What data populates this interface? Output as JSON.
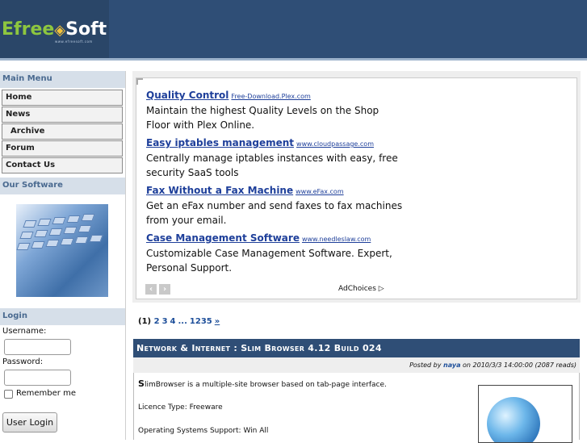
{
  "header": {
    "logo_left": "Efree",
    "logo_right": "Soft",
    "logo_sub": "www.efreesoft.com"
  },
  "sidebar": {
    "main_menu_title": "Main Menu",
    "menu": [
      {
        "label": "Home"
      },
      {
        "label": "News"
      },
      {
        "label": "Archive"
      },
      {
        "label": "Forum"
      },
      {
        "label": "Contact Us"
      }
    ],
    "our_software_title": "Our Software",
    "login_title": "Login",
    "username_label": "Username:",
    "password_label": "Password:",
    "remember_label": "Remember me",
    "login_button": "User Login"
  },
  "ads": {
    "items": [
      {
        "title": "Quality Control",
        "url": "Free-Download.Plex.com",
        "desc": "Maintain the highest Quality Levels on the Shop Floor with Plex Online."
      },
      {
        "title": "Easy iptables management",
        "url": "www.cloudpassage.com",
        "desc": "Centrally manage iptables instances with easy, free security SaaS tools"
      },
      {
        "title": "Fax Without a Fax Machine",
        "url": "www.eFax.com",
        "desc": "Get an eFax number and send faxes to fax machines from your email."
      },
      {
        "title": "Case Management Software",
        "url": "www.needleslaw.com",
        "desc": "Customizable Case Management Software. Expert, Personal Support."
      }
    ],
    "prev": "‹",
    "next": "›",
    "adchoices": "AdChoices ▷"
  },
  "pager": {
    "current": "(1)",
    "pages": [
      "2",
      "3",
      "4",
      "...",
      "1235"
    ],
    "next": "»"
  },
  "article": {
    "title": "Network & Internet : Slim Browser 4.12 Build 024",
    "meta_prefix": "Posted by",
    "author": "naya",
    "meta_suffix": "on 2010/3/3 14:00:00 (2087 reads)",
    "intro_initial": "S",
    "intro_rest": "limBrowser is a multiple-site browser based on tab-page interface.",
    "license": "Licence Type: Freeware",
    "os": "Operating Systems Support: Win All"
  }
}
